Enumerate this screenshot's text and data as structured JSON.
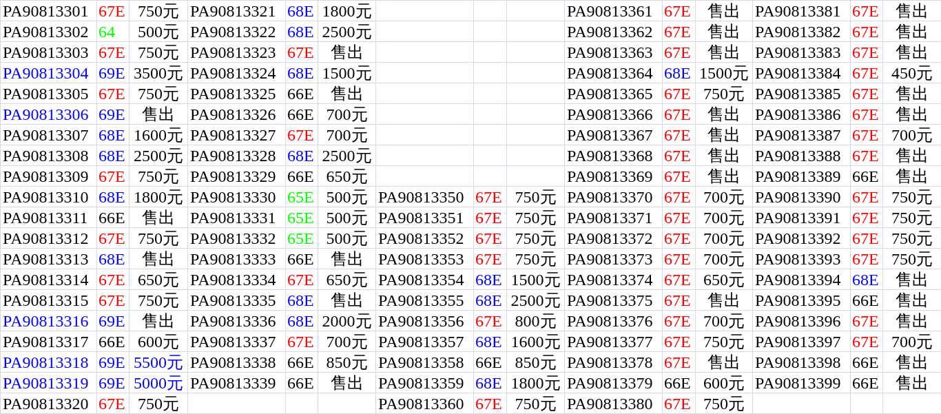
{
  "rows": [
    {
      "cells": [
        {
          "code": {
            "text": "PA90813301"
          },
          "grade": {
            "text": "67E",
            "color": "#ff0000"
          },
          "price": {
            "text": "750元"
          }
        },
        {
          "code": {
            "text": "PA90813321"
          },
          "grade": {
            "text": "68E",
            "color": "#0000ff"
          },
          "price": {
            "text": "1800元"
          }
        },
        null,
        {
          "code": {
            "text": "PA90813361"
          },
          "grade": {
            "text": "67E",
            "color": "#ff0000"
          },
          "price": {
            "text": "售出"
          }
        },
        {
          "code": {
            "text": "PA90813381"
          },
          "grade": {
            "text": "67E",
            "color": "#ff0000"
          },
          "price": {
            "text": "售出"
          }
        }
      ]
    },
    {
      "cells": [
        {
          "code": {
            "text": "PA90813302"
          },
          "grade": {
            "text": "64",
            "color": "#00ff00"
          },
          "price": {
            "text": "500元"
          }
        },
        {
          "code": {
            "text": "PA90813322"
          },
          "grade": {
            "text": "68E",
            "color": "#0000ff"
          },
          "price": {
            "text": "2500元"
          }
        },
        null,
        {
          "code": {
            "text": "PA90813362"
          },
          "grade": {
            "text": "67E",
            "color": "#ff0000"
          },
          "price": {
            "text": "售出"
          }
        },
        {
          "code": {
            "text": "PA90813382"
          },
          "grade": {
            "text": "67E",
            "color": "#ff0000"
          },
          "price": {
            "text": "售出"
          }
        }
      ]
    },
    {
      "cells": [
        {
          "code": {
            "text": "PA90813303"
          },
          "grade": {
            "text": "67E",
            "color": "#ff0000"
          },
          "price": {
            "text": "750元"
          }
        },
        {
          "code": {
            "text": "PA90813323"
          },
          "grade": {
            "text": "67E",
            "color": "#ff0000"
          },
          "price": {
            "text": "售出"
          }
        },
        null,
        {
          "code": {
            "text": "PA90813363"
          },
          "grade": {
            "text": "67E",
            "color": "#ff0000"
          },
          "price": {
            "text": "售出"
          }
        },
        {
          "code": {
            "text": "PA90813383"
          },
          "grade": {
            "text": "67E",
            "color": "#ff0000"
          },
          "price": {
            "text": "售出"
          }
        }
      ]
    },
    {
      "cells": [
        {
          "code": {
            "text": "PA90813304",
            "color": "#0000ff"
          },
          "grade": {
            "text": "69E",
            "color": "#0000ff"
          },
          "price": {
            "text": "3500元"
          }
        },
        {
          "code": {
            "text": "PA90813324"
          },
          "grade": {
            "text": "68E",
            "color": "#0000ff"
          },
          "price": {
            "text": "1500元"
          }
        },
        null,
        {
          "code": {
            "text": "PA90813364"
          },
          "grade": {
            "text": "68E",
            "color": "#0000ff"
          },
          "price": {
            "text": "1500元"
          }
        },
        {
          "code": {
            "text": "PA90813384"
          },
          "grade": {
            "text": "67E",
            "color": "#ff0000"
          },
          "price": {
            "text": "450元"
          }
        }
      ]
    },
    {
      "cells": [
        {
          "code": {
            "text": "PA90813305"
          },
          "grade": {
            "text": "67E",
            "color": "#ff0000"
          },
          "price": {
            "text": "750元"
          }
        },
        {
          "code": {
            "text": "PA90813325"
          },
          "grade": {
            "text": "66E",
            "color": "#000000"
          },
          "price": {
            "text": "售出"
          }
        },
        null,
        {
          "code": {
            "text": "PA90813365"
          },
          "grade": {
            "text": "67E",
            "color": "#ff0000"
          },
          "price": {
            "text": "750元"
          }
        },
        {
          "code": {
            "text": "PA90813385"
          },
          "grade": {
            "text": "67E",
            "color": "#ff0000"
          },
          "price": {
            "text": "售出"
          }
        }
      ]
    },
    {
      "cells": [
        {
          "code": {
            "text": "PA90813306",
            "color": "#0000ff"
          },
          "grade": {
            "text": "69E",
            "color": "#0000ff"
          },
          "price": {
            "text": "售出"
          }
        },
        {
          "code": {
            "text": "PA90813326"
          },
          "grade": {
            "text": "66E",
            "color": "#000000"
          },
          "price": {
            "text": "700元"
          }
        },
        null,
        {
          "code": {
            "text": "PA90813366"
          },
          "grade": {
            "text": "67E",
            "color": "#ff0000"
          },
          "price": {
            "text": "售出"
          }
        },
        {
          "code": {
            "text": "PA90813386"
          },
          "grade": {
            "text": "67E",
            "color": "#ff0000"
          },
          "price": {
            "text": "售出"
          }
        }
      ]
    },
    {
      "cells": [
        {
          "code": {
            "text": "PA90813307"
          },
          "grade": {
            "text": "68E",
            "color": "#0000ff"
          },
          "price": {
            "text": "1600元"
          }
        },
        {
          "code": {
            "text": "PA90813327"
          },
          "grade": {
            "text": "67E",
            "color": "#ff0000"
          },
          "price": {
            "text": "700元"
          }
        },
        null,
        {
          "code": {
            "text": "PA90813367"
          },
          "grade": {
            "text": "67E",
            "color": "#ff0000"
          },
          "price": {
            "text": "售出"
          }
        },
        {
          "code": {
            "text": "PA90813387"
          },
          "grade": {
            "text": "67E",
            "color": "#ff0000"
          },
          "price": {
            "text": "700元"
          }
        }
      ]
    },
    {
      "cells": [
        {
          "code": {
            "text": "PA90813308"
          },
          "grade": {
            "text": "68E",
            "color": "#0000ff"
          },
          "price": {
            "text": "2500元"
          }
        },
        {
          "code": {
            "text": "PA90813328"
          },
          "grade": {
            "text": "68E",
            "color": "#0000ff"
          },
          "price": {
            "text": "2500元"
          }
        },
        null,
        {
          "code": {
            "text": "PA90813368"
          },
          "grade": {
            "text": "67E",
            "color": "#ff0000"
          },
          "price": {
            "text": "售出"
          }
        },
        {
          "code": {
            "text": "PA90813388"
          },
          "grade": {
            "text": "67E",
            "color": "#ff0000"
          },
          "price": {
            "text": "售出"
          }
        }
      ]
    },
    {
      "cells": [
        {
          "code": {
            "text": "PA90813309"
          },
          "grade": {
            "text": "67E",
            "color": "#ff0000"
          },
          "price": {
            "text": "750元"
          }
        },
        {
          "code": {
            "text": "PA90813329"
          },
          "grade": {
            "text": "66E",
            "color": "#000000"
          },
          "price": {
            "text": "650元"
          }
        },
        null,
        {
          "code": {
            "text": "PA90813369"
          },
          "grade": {
            "text": "67E",
            "color": "#ff0000"
          },
          "price": {
            "text": "售出"
          }
        },
        {
          "code": {
            "text": "PA90813389"
          },
          "grade": {
            "text": "66E",
            "color": "#000000"
          },
          "price": {
            "text": "售出"
          }
        }
      ]
    },
    {
      "cells": [
        {
          "code": {
            "text": "PA90813310"
          },
          "grade": {
            "text": "68E",
            "color": "#0000ff"
          },
          "price": {
            "text": "1800元"
          }
        },
        {
          "code": {
            "text": "PA90813330"
          },
          "grade": {
            "text": "65E",
            "color": "#00ff00"
          },
          "price": {
            "text": "500元"
          }
        },
        {
          "code": {
            "text": "PA90813350"
          },
          "grade": {
            "text": "67E",
            "color": "#ff0000"
          },
          "price": {
            "text": "750元"
          }
        },
        {
          "code": {
            "text": "PA90813370"
          },
          "grade": {
            "text": "67E",
            "color": "#ff0000"
          },
          "price": {
            "text": "700元"
          }
        },
        {
          "code": {
            "text": "PA90813390"
          },
          "grade": {
            "text": "67E",
            "color": "#ff0000"
          },
          "price": {
            "text": "750元"
          }
        }
      ]
    },
    {
      "cells": [
        {
          "code": {
            "text": "PA90813311"
          },
          "grade": {
            "text": "66E",
            "color": "#000000"
          },
          "price": {
            "text": "售出"
          }
        },
        {
          "code": {
            "text": "PA90813331"
          },
          "grade": {
            "text": "65E",
            "color": "#00ff00"
          },
          "price": {
            "text": "500元"
          }
        },
        {
          "code": {
            "text": "PA90813351"
          },
          "grade": {
            "text": "67E",
            "color": "#ff0000"
          },
          "price": {
            "text": "750元"
          }
        },
        {
          "code": {
            "text": "PA90813371"
          },
          "grade": {
            "text": "67E",
            "color": "#ff0000"
          },
          "price": {
            "text": "700元"
          }
        },
        {
          "code": {
            "text": "PA90813391"
          },
          "grade": {
            "text": "67E",
            "color": "#ff0000"
          },
          "price": {
            "text": "750元"
          }
        }
      ]
    },
    {
      "cells": [
        {
          "code": {
            "text": "PA90813312"
          },
          "grade": {
            "text": "67E",
            "color": "#ff0000"
          },
          "price": {
            "text": "750元"
          }
        },
        {
          "code": {
            "text": "PA90813332"
          },
          "grade": {
            "text": "65E",
            "color": "#00ff00"
          },
          "price": {
            "text": "500元"
          }
        },
        {
          "code": {
            "text": "PA90813352"
          },
          "grade": {
            "text": "67E",
            "color": "#ff0000"
          },
          "price": {
            "text": "750元"
          }
        },
        {
          "code": {
            "text": "PA90813372"
          },
          "grade": {
            "text": "67E",
            "color": "#ff0000"
          },
          "price": {
            "text": "700元"
          }
        },
        {
          "code": {
            "text": "PA90813392"
          },
          "grade": {
            "text": "67E",
            "color": "#ff0000"
          },
          "price": {
            "text": "750元"
          }
        }
      ]
    },
    {
      "cells": [
        {
          "code": {
            "text": "PA90813313"
          },
          "grade": {
            "text": "68E",
            "color": "#0000ff"
          },
          "price": {
            "text": "售出"
          }
        },
        {
          "code": {
            "text": "PA90813333"
          },
          "grade": {
            "text": "66E",
            "color": "#000000"
          },
          "price": {
            "text": "售出"
          }
        },
        {
          "code": {
            "text": "PA90813353"
          },
          "grade": {
            "text": "67E",
            "color": "#ff0000"
          },
          "price": {
            "text": "750元"
          }
        },
        {
          "code": {
            "text": "PA90813373"
          },
          "grade": {
            "text": "67E",
            "color": "#ff0000"
          },
          "price": {
            "text": "700元"
          }
        },
        {
          "code": {
            "text": "PA90813393"
          },
          "grade": {
            "text": "67E",
            "color": "#ff0000"
          },
          "price": {
            "text": "750元"
          }
        }
      ]
    },
    {
      "cells": [
        {
          "code": {
            "text": "PA90813314"
          },
          "grade": {
            "text": "67E",
            "color": "#ff0000"
          },
          "price": {
            "text": "650元"
          }
        },
        {
          "code": {
            "text": "PA90813334"
          },
          "grade": {
            "text": "67E",
            "color": "#ff0000"
          },
          "price": {
            "text": "650元"
          }
        },
        {
          "code": {
            "text": "PA90813354"
          },
          "grade": {
            "text": "68E",
            "color": "#0000ff"
          },
          "price": {
            "text": "1500元"
          }
        },
        {
          "code": {
            "text": "PA90813374"
          },
          "grade": {
            "text": "67E",
            "color": "#ff0000"
          },
          "price": {
            "text": "650元"
          }
        },
        {
          "code": {
            "text": "PA90813394"
          },
          "grade": {
            "text": "68E",
            "color": "#0000ff"
          },
          "price": {
            "text": "售出"
          }
        }
      ]
    },
    {
      "cells": [
        {
          "code": {
            "text": "PA90813315"
          },
          "grade": {
            "text": "67E",
            "color": "#ff0000"
          },
          "price": {
            "text": "750元"
          }
        },
        {
          "code": {
            "text": "PA90813335"
          },
          "grade": {
            "text": "68E",
            "color": "#0000ff"
          },
          "price": {
            "text": "售出"
          }
        },
        {
          "code": {
            "text": "PA90813355"
          },
          "grade": {
            "text": "68E",
            "color": "#0000ff"
          },
          "price": {
            "text": "2500元"
          }
        },
        {
          "code": {
            "text": "PA90813375"
          },
          "grade": {
            "text": "67E",
            "color": "#ff0000"
          },
          "price": {
            "text": "售出"
          }
        },
        {
          "code": {
            "text": "PA90813395"
          },
          "grade": {
            "text": "66E",
            "color": "#000000"
          },
          "price": {
            "text": "售出"
          }
        }
      ]
    },
    {
      "cells": [
        {
          "code": {
            "text": "PA90813316",
            "color": "#0000ff"
          },
          "grade": {
            "text": "69E",
            "color": "#0000ff"
          },
          "price": {
            "text": "售出"
          }
        },
        {
          "code": {
            "text": "PA90813336"
          },
          "grade": {
            "text": "68E",
            "color": "#0000ff"
          },
          "price": {
            "text": "2000元"
          }
        },
        {
          "code": {
            "text": "PA90813356"
          },
          "grade": {
            "text": "67E",
            "color": "#ff0000"
          },
          "price": {
            "text": "800元"
          }
        },
        {
          "code": {
            "text": "PA90813376"
          },
          "grade": {
            "text": "67E",
            "color": "#ff0000"
          },
          "price": {
            "text": "700元"
          }
        },
        {
          "code": {
            "text": "PA90813396"
          },
          "grade": {
            "text": "67E",
            "color": "#ff0000"
          },
          "price": {
            "text": "售出"
          }
        }
      ]
    },
    {
      "cells": [
        {
          "code": {
            "text": "PA90813317"
          },
          "grade": {
            "text": "66E",
            "color": "#000000"
          },
          "price": {
            "text": "600元"
          }
        },
        {
          "code": {
            "text": "PA90813337"
          },
          "grade": {
            "text": "67E",
            "color": "#ff0000"
          },
          "price": {
            "text": "700元"
          }
        },
        {
          "code": {
            "text": "PA90813357"
          },
          "grade": {
            "text": "68E",
            "color": "#0000ff"
          },
          "price": {
            "text": "1600元"
          }
        },
        {
          "code": {
            "text": "PA90813377"
          },
          "grade": {
            "text": "67E",
            "color": "#ff0000"
          },
          "price": {
            "text": "750元"
          }
        },
        {
          "code": {
            "text": "PA90813397"
          },
          "grade": {
            "text": "67E",
            "color": "#ff0000"
          },
          "price": {
            "text": "700元"
          }
        }
      ]
    },
    {
      "cells": [
        {
          "code": {
            "text": "PA90813318",
            "color": "#0000ff"
          },
          "grade": {
            "text": "69E",
            "color": "#0000ff"
          },
          "price": {
            "text": "5500元",
            "color": "#0000ff"
          }
        },
        {
          "code": {
            "text": "PA90813338"
          },
          "grade": {
            "text": "66E",
            "color": "#000000"
          },
          "price": {
            "text": "850元"
          }
        },
        {
          "code": {
            "text": "PA90813358"
          },
          "grade": {
            "text": "66E",
            "color": "#000000"
          },
          "price": {
            "text": "850元"
          }
        },
        {
          "code": {
            "text": "PA90813378"
          },
          "grade": {
            "text": "67E",
            "color": "#ff0000"
          },
          "price": {
            "text": "售出"
          }
        },
        {
          "code": {
            "text": "PA90813398"
          },
          "grade": {
            "text": "66E",
            "color": "#000000"
          },
          "price": {
            "text": "售出"
          }
        }
      ]
    },
    {
      "cells": [
        {
          "code": {
            "text": "PA90813319",
            "color": "#0000ff"
          },
          "grade": {
            "text": "69E",
            "color": "#0000ff"
          },
          "price": {
            "text": "5000元",
            "color": "#0000ff"
          }
        },
        {
          "code": {
            "text": "PA90813339"
          },
          "grade": {
            "text": "66E",
            "color": "#000000"
          },
          "price": {
            "text": "售出"
          }
        },
        {
          "code": {
            "text": "PA90813359"
          },
          "grade": {
            "text": "68E",
            "color": "#0000ff"
          },
          "price": {
            "text": "1800元"
          }
        },
        {
          "code": {
            "text": "PA90813379"
          },
          "grade": {
            "text": "66E",
            "color": "#000000"
          },
          "price": {
            "text": "600元"
          }
        },
        {
          "code": {
            "text": "PA90813399"
          },
          "grade": {
            "text": "66E",
            "color": "#000000"
          },
          "price": {
            "text": "售出"
          }
        }
      ]
    },
    {
      "cells": [
        {
          "code": {
            "text": "PA90813320"
          },
          "grade": {
            "text": "67E",
            "color": "#ff0000"
          },
          "price": {
            "text": "750元"
          }
        },
        null,
        {
          "code": {
            "text": "PA90813360"
          },
          "grade": {
            "text": "67E",
            "color": "#ff0000"
          },
          "price": {
            "text": "750元"
          }
        },
        {
          "code": {
            "text": "PA90813380"
          },
          "grade": {
            "text": "67E",
            "color": "#ff0000"
          },
          "price": {
            "text": "750元"
          }
        },
        null
      ]
    }
  ]
}
